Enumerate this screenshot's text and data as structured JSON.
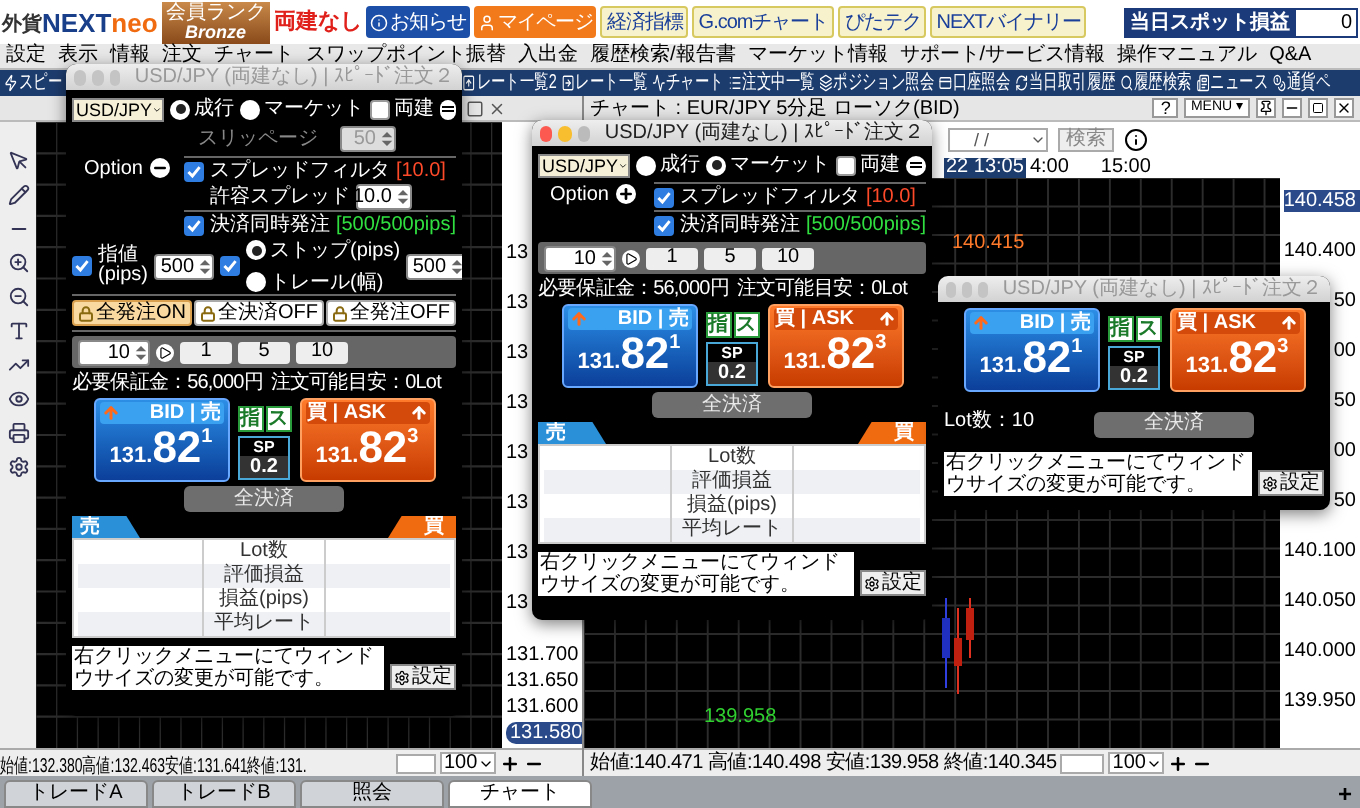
{
  "header": {
    "logo": {
      "prefix": "外貨",
      "name": "NEXT",
      "suffix": "neo"
    },
    "rank": {
      "caption": "会員ランク",
      "value": "Bronze"
    },
    "hedge_status": "両建なし",
    "buttons": [
      {
        "label": "お知らせ",
        "kind": "notice"
      },
      {
        "label": "マイページ",
        "kind": "mypage"
      },
      {
        "label": "経済指標",
        "kind": "link"
      },
      {
        "label": "G.comチャート",
        "kind": "link"
      },
      {
        "label": "ぴたテク",
        "kind": "link"
      },
      {
        "label": "NEXTバイナリー",
        "kind": "link"
      }
    ],
    "spot_pl": {
      "label": "当日スポット損益",
      "value": "0"
    }
  },
  "menu": [
    "設定",
    "表示",
    "情報",
    "注文",
    "チャート",
    "スワップポイント振替",
    "入出金",
    "履歴検索/報告書",
    "マーケット情報",
    "サポート/サービス情報",
    "操作マニュアル",
    "Q&A"
  ],
  "toolbar": [
    "スピー",
    "レート一覧2",
    "レート一覧",
    "チャート",
    "注文中一覧",
    "ポジション照会",
    "口座照会",
    "当日取引履歴",
    "履歴検索",
    "ニュース",
    "通貨ペ"
  ],
  "left_chart": {
    "axis_fragments": [
      "13",
      "13",
      "13",
      "13",
      "13",
      "13",
      "13",
      "13"
    ],
    "axis_labels": [
      "131.700",
      "131.650",
      "131.600"
    ],
    "current_price": "131.580",
    "status": "始値:132.380高値:132.463安値:131.641終値:131.",
    "zoom": "100"
  },
  "right_chart": {
    "title": "チャート : EUR/JPY 5分足 ローソク(BID)",
    "help": "?",
    "menu": "MENU ▾",
    "date_placeholder": "/ /",
    "search": "検索",
    "times": [
      {
        "label": "22 13:05",
        "selected": true
      },
      {
        "label": "4:00",
        "selected": false
      },
      {
        "label": "15:00",
        "selected": false
      }
    ],
    "axis_labels": [
      {
        "label": "140.458",
        "selected": true
      },
      {
        "label": "140.400",
        "selected": false
      },
      {
        "label": "50",
        "selected": false
      },
      {
        "label": "00",
        "selected": false
      },
      {
        "label": "50",
        "selected": false
      },
      {
        "label": "00",
        "selected": false
      },
      {
        "label": "50",
        "selected": false
      },
      {
        "label": "140.100",
        "selected": false
      },
      {
        "label": "140.050",
        "selected": false
      },
      {
        "label": "140.000",
        "selected": false
      },
      {
        "label": "139.950",
        "selected": false
      }
    ],
    "high_label": "140.415",
    "low_label": "139.958",
    "status": "始値:140.471 高値:140.498 安値:139.958 終値:140.345",
    "zoom": "100"
  },
  "windows": [
    {
      "kind": "full",
      "title": "USD/JPY (両建なし) | ｽﾋﾟｰﾄﾞ注文２",
      "active": false,
      "pair": "USD/JPY",
      "order_types": [
        {
          "label": "成行",
          "selected": true
        },
        {
          "label": "マーケット",
          "selected": false
        }
      ],
      "hedge": {
        "label": "両建",
        "checked": false
      },
      "slippage": {
        "label": "スリッページ",
        "value": "50",
        "disabled": true
      },
      "option": {
        "label": "Option",
        "expanded": true
      },
      "spread_filter": {
        "label": "スプレッドフィルタ",
        "checked": true,
        "value": "[10.0]"
      },
      "allowed_spread": {
        "label": "許容スプレッド",
        "value": "10.0"
      },
      "settlement": {
        "label": "決済同時発注",
        "checked": true,
        "value": "[500/500pips]"
      },
      "limit": {
        "label": "指値 (pips)",
        "checked": true,
        "value": "500"
      },
      "stop": {
        "checked": true,
        "modes": [
          {
            "label": "ストップ(pips)",
            "selected": true
          },
          {
            "label": "トレール(幅)",
            "selected": false
          }
        ],
        "value": "500"
      },
      "lock_buttons": [
        {
          "label": "全発注ON",
          "on": true
        },
        {
          "label": "全決済OFF",
          "on": false
        },
        {
          "label": "全発注OFF",
          "on": false
        }
      ],
      "lot": {
        "value": "10",
        "presets": [
          "1",
          "5",
          "10"
        ]
      },
      "margin": "必要保証金：56,000円",
      "capacity": "注文可能目安：0Lot",
      "bid": {
        "label": "BID | 売",
        "prefix": "131.",
        "pips": "82",
        "fraction": "1"
      },
      "ask": {
        "label": "買 | ASK",
        "prefix": "131.",
        "pips": "82",
        "fraction": "3"
      },
      "flags": [
        "指",
        "ス"
      ],
      "spread": {
        "label": "SP",
        "value": "0.2"
      },
      "close_all": {
        "label": "全決済",
        "disabled": true
      },
      "positions": {
        "sell": "売",
        "buy": "買",
        "rows": [
          "Lot数",
          "評価損益",
          "損益(pips)",
          "平均レート"
        ]
      },
      "note": "右クリックメニューにてウィンドウサイズの変更が可能です。",
      "settings": "設定"
    },
    {
      "kind": "standard",
      "title": "USD/JPY (両建なし) | ｽﾋﾟｰﾄﾞ注文２",
      "active": true,
      "pair": "USD/JPY",
      "order_types": [
        {
          "label": "成行",
          "selected": false
        },
        {
          "label": "マーケット",
          "selected": true
        }
      ],
      "hedge": {
        "label": "両建",
        "checked": false
      },
      "option": {
        "label": "Option",
        "expanded": false
      },
      "spread_filter": {
        "label": "スプレッドフィルタ",
        "checked": true,
        "value": "[10.0]"
      },
      "settlement": {
        "label": "決済同時発注",
        "checked": true,
        "value": "[500/500pips]"
      },
      "lot": {
        "value": "10",
        "presets": [
          "1",
          "5",
          "10"
        ]
      },
      "margin": "必要保証金：56,000円",
      "capacity": "注文可能目安：0Lot",
      "bid": {
        "label": "BID | 売",
        "prefix": "131.",
        "pips": "82",
        "fraction": "1"
      },
      "ask": {
        "label": "買 | ASK",
        "prefix": "131.",
        "pips": "82",
        "fraction": "3"
      },
      "flags": [
        "指",
        "ス"
      ],
      "spread": {
        "label": "SP",
        "value": "0.2"
      },
      "close_all": {
        "label": "全決済",
        "disabled": true
      },
      "positions": {
        "sell": "売",
        "buy": "買",
        "rows": [
          "Lot数",
          "評価損益",
          "損益(pips)",
          "平均レート"
        ]
      },
      "note": "右クリックメニューにてウィンドウサイズの変更が可能です。",
      "settings": "設定"
    },
    {
      "kind": "compact",
      "title": "USD/JPY (両建なし) | ｽﾋﾟｰﾄﾞ注文２",
      "active": false,
      "bid": {
        "label": "BID | 売",
        "prefix": "131.",
        "pips": "82",
        "fraction": "1"
      },
      "ask": {
        "label": "買 | ASK",
        "prefix": "131.",
        "pips": "82",
        "fraction": "3"
      },
      "flags": [
        "指",
        "ス"
      ],
      "spread": {
        "label": "SP",
        "value": "0.2"
      },
      "lot_count": "Lot数：10",
      "close_all": {
        "label": "全決済",
        "disabled": true
      },
      "note": "右クリックメニューにてウィンドウサイズの変更が可能です。",
      "settings": "設定"
    }
  ],
  "tabs": [
    {
      "label": "トレードA",
      "selected": false
    },
    {
      "label": "トレードB",
      "selected": false
    },
    {
      "label": "照会",
      "selected": false
    },
    {
      "label": "チャート",
      "selected": true
    }
  ],
  "add_tab": "+"
}
